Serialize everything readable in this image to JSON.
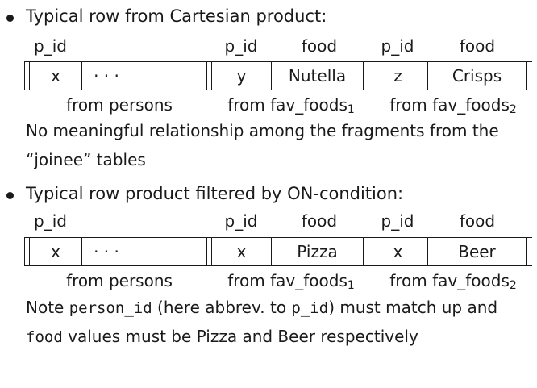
{
  "bullet1": {
    "title": "Typical row from Cartesian product:",
    "headers": [
      "p_id",
      "p_id",
      "food",
      "p_id",
      "food"
    ],
    "cells": [
      "x",
      "· · ·",
      "y",
      "Nutella",
      "z",
      "Crisps"
    ],
    "from_persons": "from persons",
    "from_fav_foods_1": "from fav_foods",
    "sub_1": "1",
    "from_fav_foods_2": "from fav_foods",
    "sub_2": "2",
    "note_line1": "No meaningful relationship among the fragments from the",
    "note_line2": "“joinee” tables"
  },
  "bullet2": {
    "title": "Typical row product filtered by ON-condition:",
    "headers": [
      "p_id",
      "p_id",
      "food",
      "p_id",
      "food"
    ],
    "cells": [
      "x",
      "· · ·",
      "x",
      "Pizza",
      "x",
      "Beer"
    ],
    "from_persons": "from persons",
    "from_fav_foods_1": "from fav_foods",
    "sub_1": "1",
    "from_fav_foods_2": "from fav_foods",
    "sub_2": "2",
    "note_a": "Note ",
    "note_code1": "person_id",
    "note_b": " (here abbrev. to ",
    "note_code2": "p_id",
    "note_c": ") must match up and",
    "note_code3": "food",
    "note_d": " values must be Pizza and Beer respectively"
  }
}
